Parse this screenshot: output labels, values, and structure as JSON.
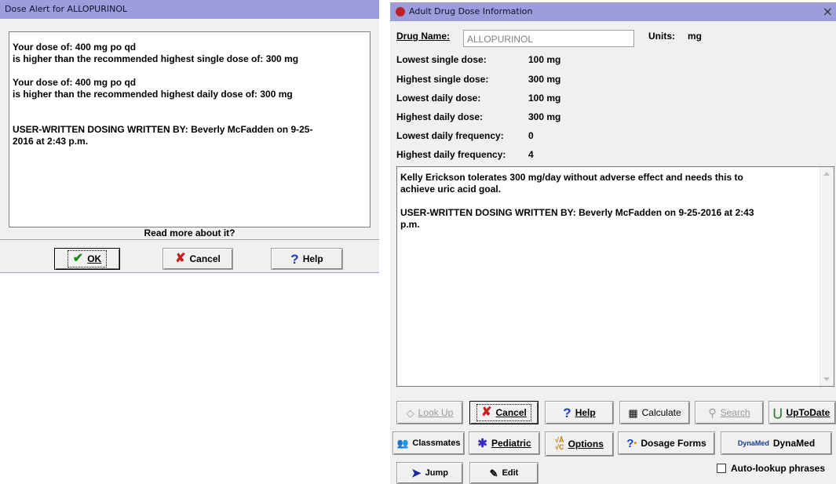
{
  "left_dialog": {
    "title": "Dose Alert for ALLOPURINOL",
    "messages": [
      "Your dose of: 400 mg po qd",
      "is higher than the recommended highest single dose of: 300 mg",
      "Your dose of: 400 mg po qd",
      "is higher than the recommended highest daily dose of: 300 mg",
      "USER-WRITTEN DOSING WRITTEN BY: Beverly McFadden on 9-25-",
      "2016 at 2:43 p.m."
    ],
    "read_more": "Read more about it?",
    "buttons": {
      "ok": "OK",
      "cancel": "Cancel",
      "help": "Help"
    }
  },
  "right_dialog": {
    "title": "Adult Drug Dose Information",
    "close": "×",
    "drug_name_label": "Drug Name:",
    "drug_name_value": "ALLOPURINOL",
    "units_label": "Units:",
    "units_value": "mg",
    "fields": [
      {
        "label": "Lowest single dose:",
        "value": "100 mg"
      },
      {
        "label": "Highest single dose:",
        "value": "300 mg"
      },
      {
        "label": "Lowest daily dose:",
        "value": "100 mg"
      },
      {
        "label": "Highest daily dose:",
        "value": "300 mg"
      },
      {
        "label": "Lowest daily frequency:",
        "value": "0"
      },
      {
        "label": "Highest daily frequency:",
        "value": "4"
      }
    ],
    "notes": [
      "Kelly Erickson tolerates 300 mg/day without adverse effect and needs this to",
      "achieve uric acid goal.",
      "USER-WRITTEN DOSING WRITTEN BY: Beverly McFadden on 9-25-2016 at 2:43",
      "p.m."
    ],
    "buttons": {
      "look_up": "Look Up",
      "cancel": "Cancel",
      "help": "Help",
      "calculate": "Calculate",
      "search": "Search",
      "uptodate": "UpToDate",
      "classmates": "Classmates",
      "pediatric": "Pediatric",
      "options": "Options",
      "dosage_forms": "Dosage Forms",
      "dynamed_logo": "DynaMed",
      "dynamed": "DynaMed",
      "jump": "Jump",
      "edit": "Edit"
    },
    "auto_lookup_label": "Auto-lookup phrases",
    "auto_lookup_checked": false
  }
}
